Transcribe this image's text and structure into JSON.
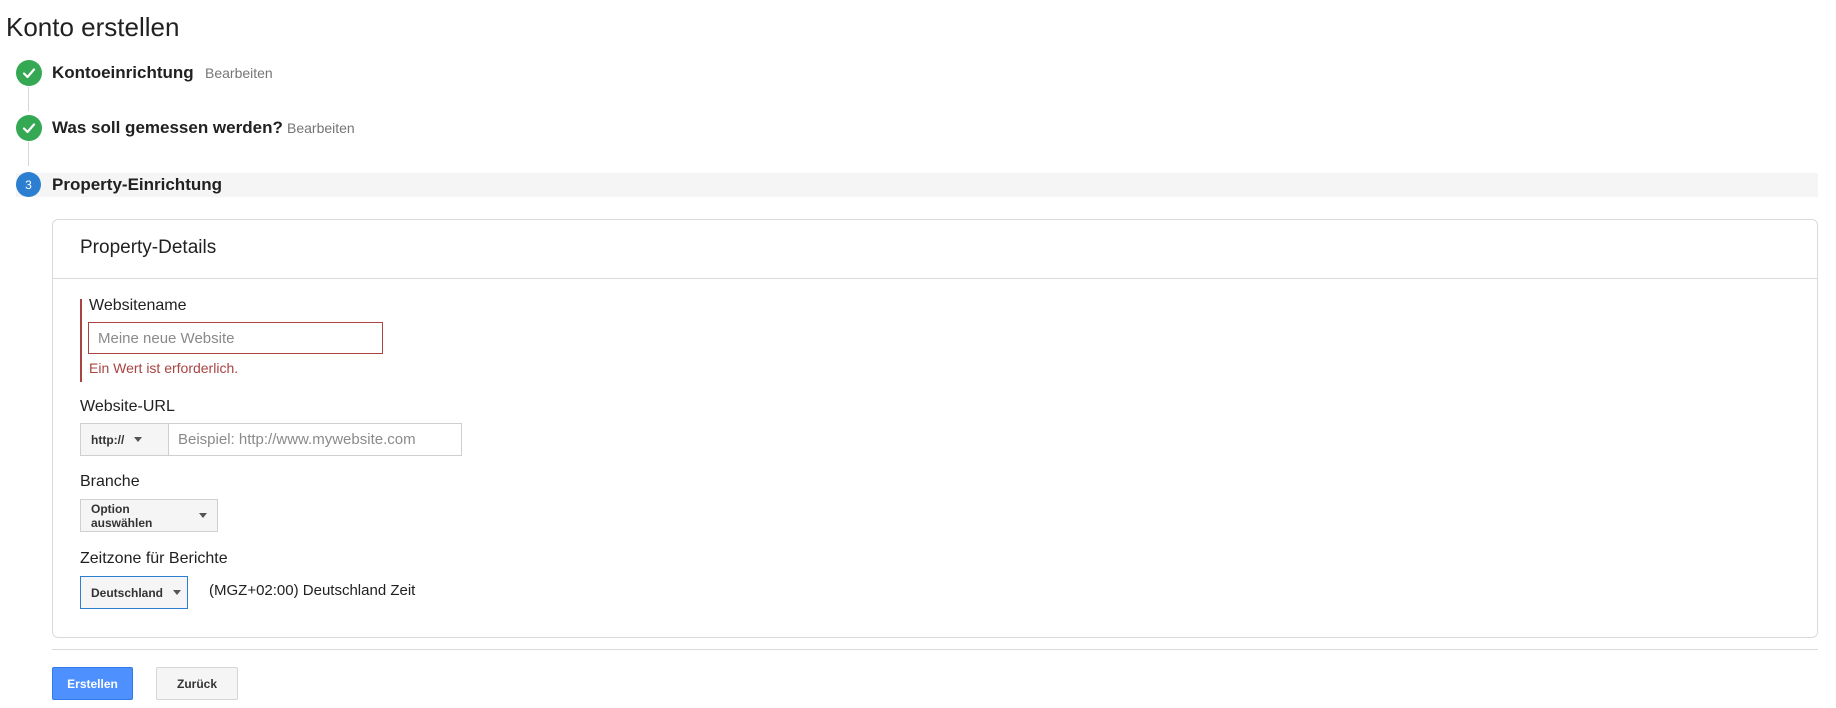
{
  "page": {
    "title": "Konto erstellen"
  },
  "steps": [
    {
      "label": "Kontoeinrichtung",
      "edit_label": "Bearbeiten",
      "status": "done"
    },
    {
      "label": "Was soll gemessen werden?",
      "edit_label": "Bearbeiten",
      "status": "done"
    },
    {
      "label": "Property-Einrichtung",
      "number": "3",
      "status": "active"
    }
  ],
  "card": {
    "title": "Property-Details",
    "website_name": {
      "label": "Websitename",
      "placeholder": "Meine neue Website",
      "value": "",
      "error": "Ein Wert ist erforderlich."
    },
    "website_url": {
      "label": "Website-URL",
      "protocol": "http://",
      "placeholder": "Beispiel: http://www.mywebsite.com",
      "value": ""
    },
    "industry": {
      "label": "Branche",
      "selected": "Option auswählen"
    },
    "timezone": {
      "label": "Zeitzone für Berichte",
      "country": "Deutschland",
      "zone_text": "(MGZ+02:00) Deutschland Zeit"
    }
  },
  "actions": {
    "create_label": "Erstellen",
    "back_label": "Zurück"
  },
  "colors": {
    "success": "#34a853",
    "active_step": "#2c7fd0",
    "error": "#a94442",
    "primary_button": "#4d90fe"
  },
  "icons": {
    "done_step": "check-icon",
    "dropdown": "caret-down-icon"
  }
}
